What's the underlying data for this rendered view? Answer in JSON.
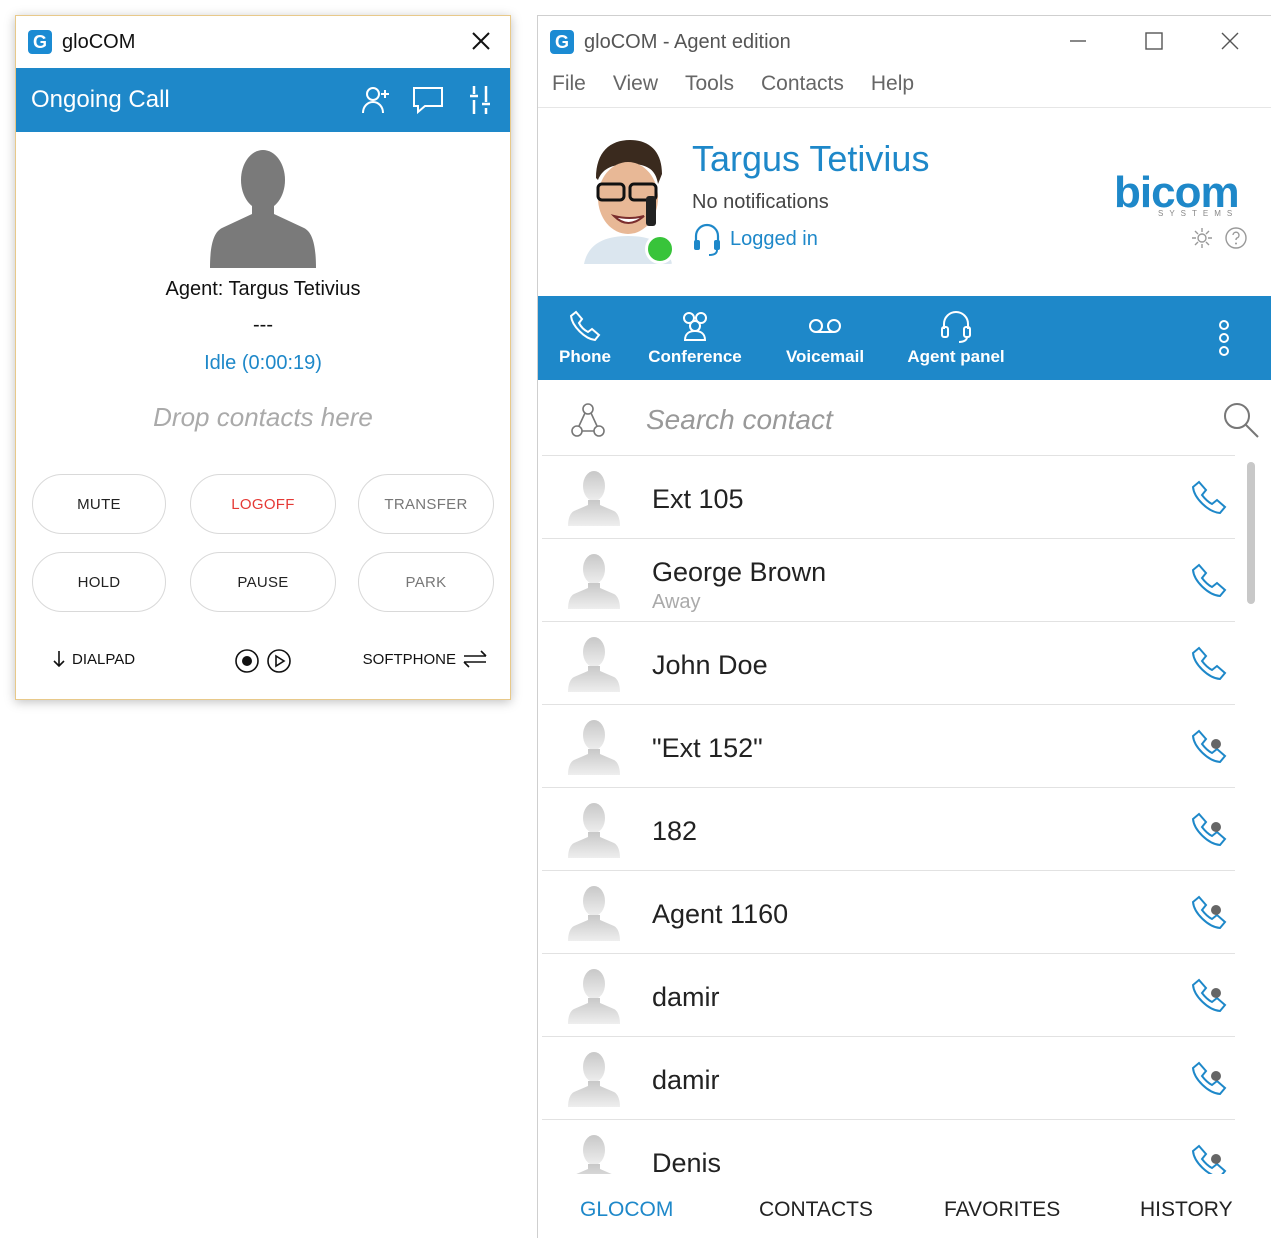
{
  "left_window": {
    "title": "gloCOM",
    "header_title": "Ongoing Call",
    "agent_label": "Agent: Targus Tetivius",
    "separator": "---",
    "status": "Idle (0:00:19)",
    "drop_hint": "Drop contacts here",
    "buttons": {
      "mute": "MUTE",
      "logoff": "LOGOFF",
      "transfer": "TRANSFER",
      "hold": "HOLD",
      "pause": "PAUSE",
      "park": "PARK"
    },
    "footer": {
      "dialpad": "DIALPAD",
      "softphone": "SOFTPHONE"
    },
    "colors": {
      "accent": "#1e88c9",
      "logoff": "#e53935"
    }
  },
  "right_window": {
    "title": "gloCOM - Agent edition",
    "menu": [
      "File",
      "View",
      "Tools",
      "Contacts",
      "Help"
    ],
    "profile": {
      "name": "Targus Tetivius",
      "notifications": "No notifications",
      "status": "Logged in",
      "status_color": "#38c43a"
    },
    "brand": {
      "name": "bicom",
      "tagline": "SYSTEMS"
    },
    "nav": [
      {
        "label": "Phone",
        "icon": "phone-icon"
      },
      {
        "label": "Conference",
        "icon": "conference-icon"
      },
      {
        "label": "Voicemail",
        "icon": "voicemail-icon"
      },
      {
        "label": "Agent panel",
        "icon": "headset-icon"
      }
    ],
    "search": {
      "placeholder": "Search contact"
    },
    "contacts": [
      {
        "name": "Ext 105",
        "sub": "",
        "icon": "phone-icon"
      },
      {
        "name": "George Brown",
        "sub": "Away",
        "icon": "phone-icon"
      },
      {
        "name": "John Doe",
        "sub": "",
        "icon": "phone-icon"
      },
      {
        "name": "\"Ext 152\"",
        "sub": "",
        "icon": "phone-dot-icon"
      },
      {
        "name": "182",
        "sub": "",
        "icon": "phone-dot-icon"
      },
      {
        "name": "Agent 1160",
        "sub": "",
        "icon": "phone-dot-icon"
      },
      {
        "name": "damir",
        "sub": "",
        "icon": "phone-dot-icon"
      },
      {
        "name": "damir",
        "sub": "",
        "icon": "phone-dot-icon"
      },
      {
        "name": "Denis",
        "sub": "",
        "icon": "phone-dot-icon"
      }
    ],
    "tabs": [
      "GLOCOM",
      "CONTACTS",
      "FAVORITES",
      "HISTORY"
    ],
    "active_tab": "GLOCOM"
  }
}
